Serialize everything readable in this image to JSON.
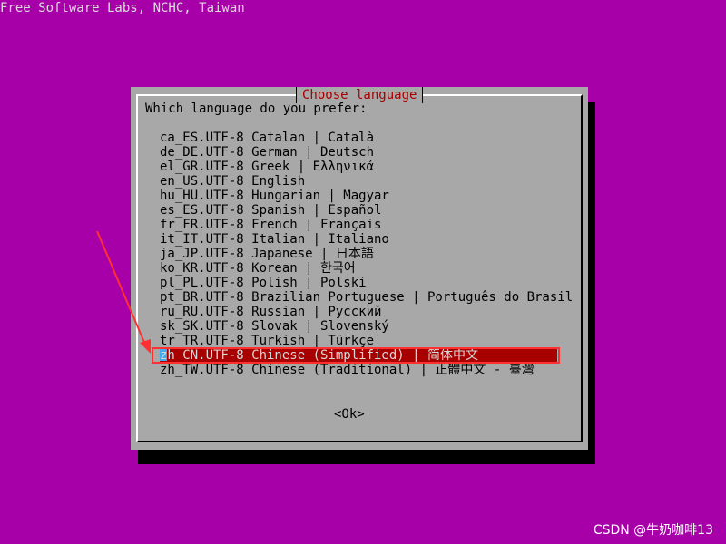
{
  "header": {
    "text": "Free Software Labs, NCHC, Taiwan"
  },
  "dialog": {
    "title": "Choose language",
    "prompt": "Which language do you prefer:",
    "ok_label": "<Ok>",
    "selected_index": 15,
    "items": [
      "ca_ES.UTF-8 Catalan | Català",
      "de_DE.UTF-8 German | Deutsch",
      "el_GR.UTF-8 Greek | Ελληνικά",
      "en_US.UTF-8 English",
      "hu_HU.UTF-8 Hungarian | Magyar",
      "es_ES.UTF-8 Spanish | Español",
      "fr_FR.UTF-8 French | Français",
      "it_IT.UTF-8 Italian | Italiano",
      "ja_JP.UTF-8 Japanese | 日本語",
      "ko_KR.UTF-8 Korean | 한국어",
      "pl_PL.UTF-8 Polish | Polski",
      "pt_BR.UTF-8 Brazilian Portuguese | Português do Brasil",
      "ru_RU.UTF-8 Russian | Русский",
      "sk_SK.UTF-8 Slovak | Slovenský",
      "tr_TR.UTF-8 Turkish | Türkçe",
      "zh_CN.UTF-8 Chinese (Simplified) | 简体中文",
      "zh_TW.UTF-8 Chinese (Traditional) | 正體中文 - 臺灣"
    ]
  },
  "watermark": "CSDN @牛奶咖啡13",
  "colors": {
    "background": "#a800a8",
    "dialog": "#a8a8a8",
    "title": "#a80000",
    "selection": "#a80000",
    "annotation": "#ff3030"
  }
}
